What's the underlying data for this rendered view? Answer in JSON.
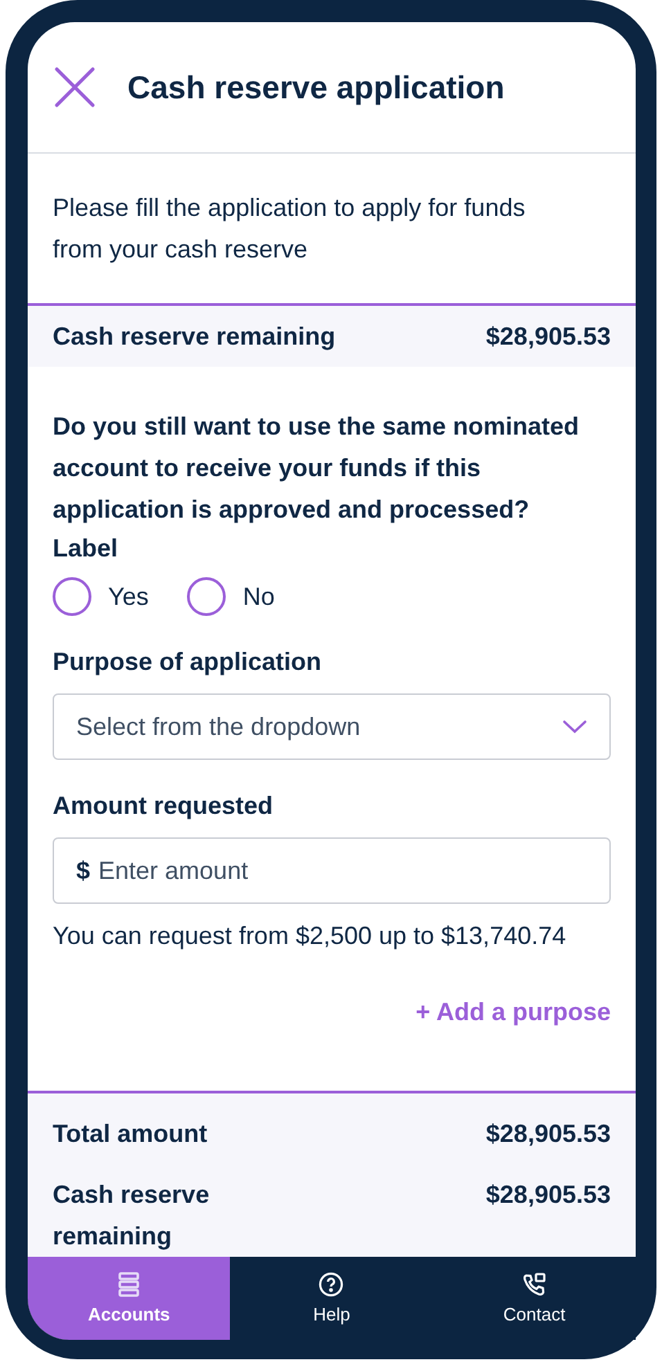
{
  "header": {
    "title": "Cash reserve application"
  },
  "intro": "Please fill the application to apply for funds from your cash reserve",
  "reserve": {
    "label": "Cash reserve remaining",
    "value": "$28,905.53"
  },
  "question": "Do you still want to use the same nominated account to receive your funds if this application is approved and processed?",
  "question_label": "Label",
  "options": [
    {
      "label": "Yes",
      "selected": false
    },
    {
      "label": "No",
      "selected": false
    }
  ],
  "purpose": {
    "label": "Purpose of application",
    "placeholder": "Select from the dropdown"
  },
  "amount": {
    "label": "Amount requested",
    "currency": "$",
    "placeholder": "Enter amount",
    "hint": "You can request from $2,500 up to $13,740.74"
  },
  "add_link": "+ Add a purpose",
  "summary": [
    {
      "label": "Total amount",
      "value": "$28,905.53"
    },
    {
      "label": "Cash reserve remaining",
      "value": "$28,905.53"
    }
  ],
  "nav": [
    {
      "label": "Accounts",
      "selected": true
    },
    {
      "label": "Help",
      "selected": false
    },
    {
      "label": "Contact",
      "selected": false
    }
  ]
}
